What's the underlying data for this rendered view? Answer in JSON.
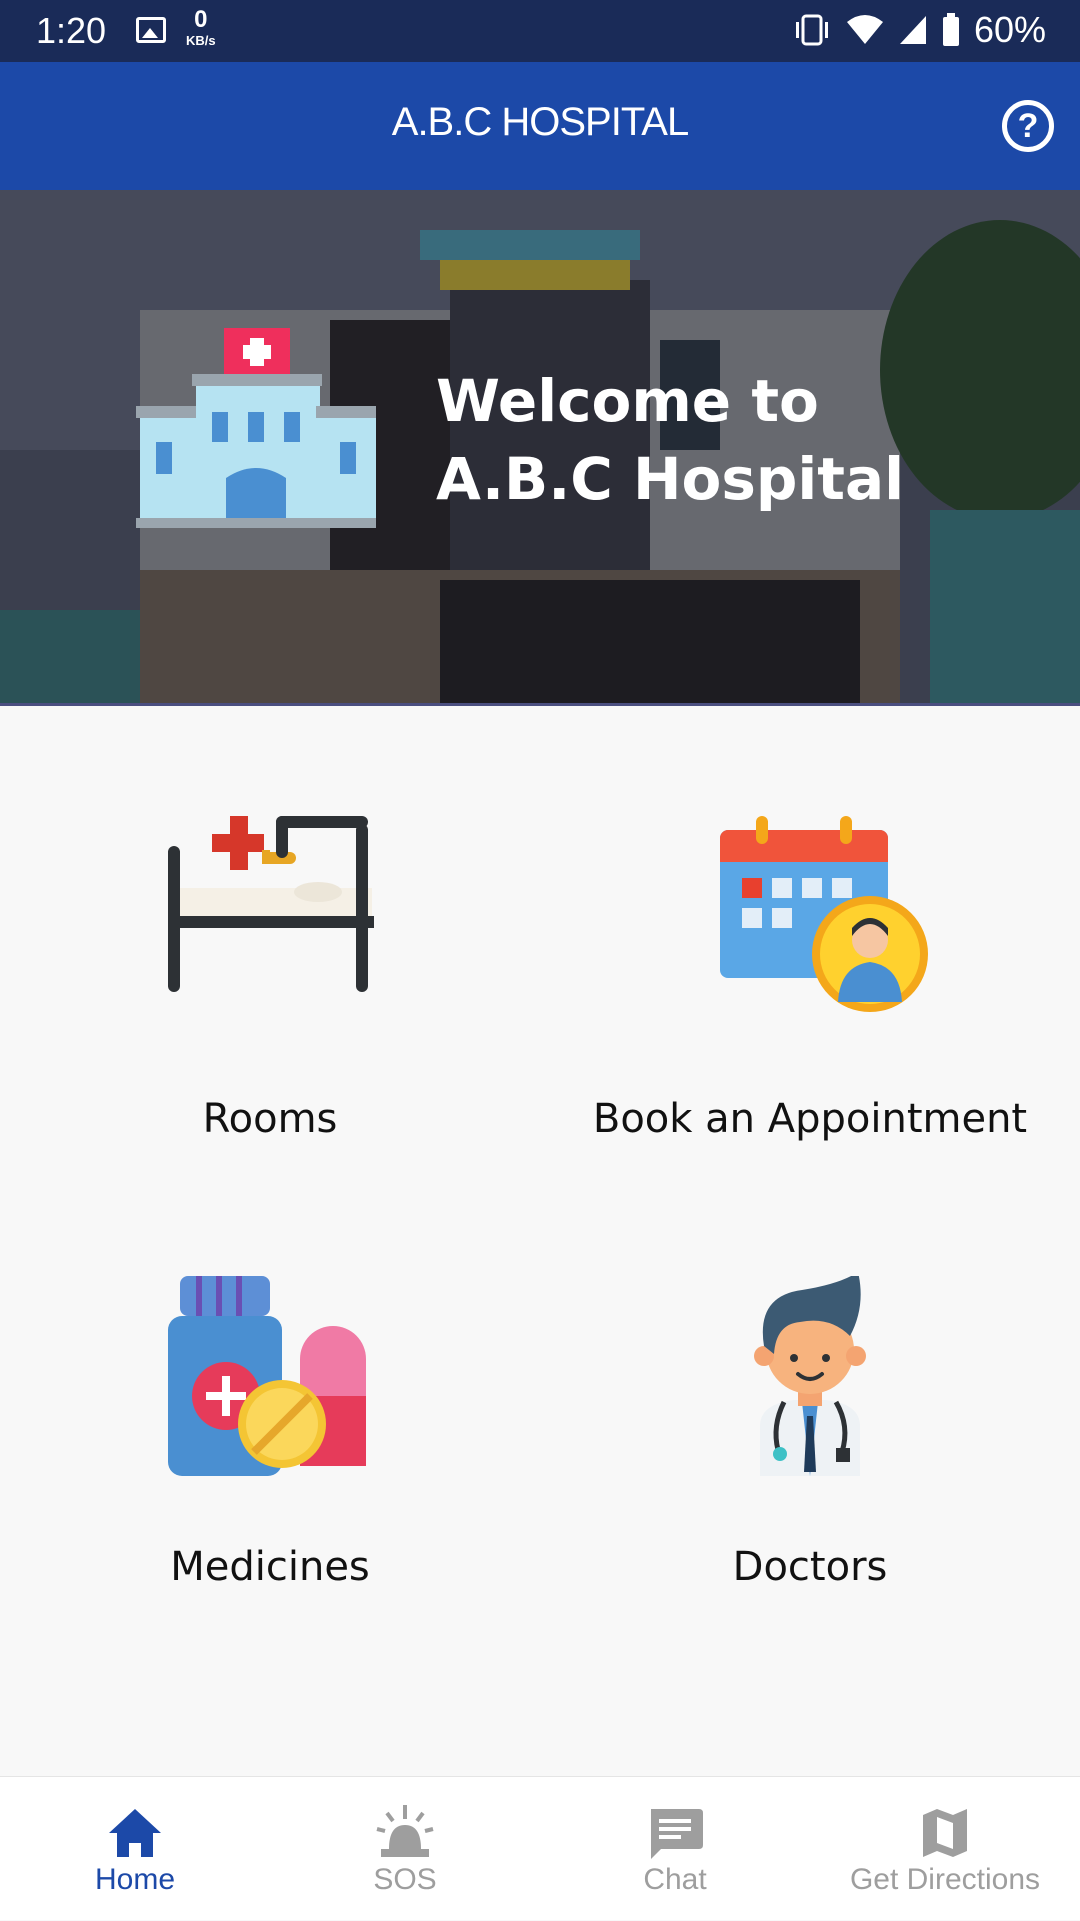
{
  "status_bar": {
    "time": "1:20",
    "net_speed_value": "0",
    "net_speed_unit": "KB/s",
    "battery": "60%"
  },
  "app_bar": {
    "title": "A.B.C HOSPITAL",
    "help_icon": "help-circle-icon"
  },
  "hero": {
    "line1": "Welcome to",
    "line2": "A.B.C Hospital"
  },
  "tiles": [
    {
      "label": "Rooms",
      "icon": "hospital-bed-icon"
    },
    {
      "label": "Book an Appointment",
      "icon": "calendar-doctor-icon"
    },
    {
      "label": "Medicines",
      "icon": "medicine-bottle-pills-icon"
    },
    {
      "label": "Doctors",
      "icon": "doctor-icon"
    }
  ],
  "bottom_nav": [
    {
      "label": "Home",
      "icon": "home-icon",
      "active": true
    },
    {
      "label": "SOS",
      "icon": "siren-icon",
      "active": false
    },
    {
      "label": "Chat",
      "icon": "chat-icon",
      "active": false
    },
    {
      "label": "Get Directions",
      "icon": "map-icon",
      "active": false
    }
  ],
  "colors": {
    "status_bar": "#1a2b58",
    "app_bar": "#1c49a8",
    "active_nav": "#1c49a8",
    "inactive_nav": "#9e9e9e",
    "background": "#f8f8f8"
  }
}
